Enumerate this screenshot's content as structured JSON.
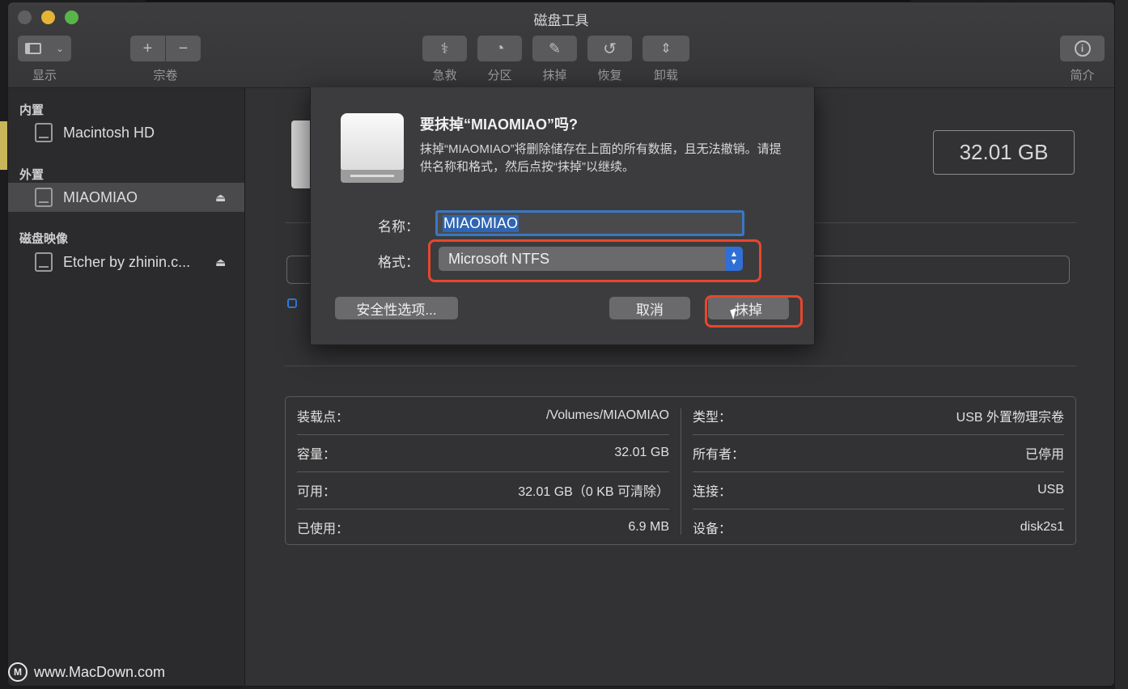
{
  "window": {
    "title": "磁盘工具"
  },
  "toolbar": {
    "view_label": "显示",
    "volume_label": "宗卷",
    "firstaid_label": "急救",
    "partition_label": "分区",
    "erase_label": "抹掉",
    "restore_label": "恢复",
    "unmount_label": "卸载",
    "info_label": "简介"
  },
  "sidebar": {
    "internal_header": "内置",
    "external_header": "外置",
    "images_header": "磁盘映像",
    "items": [
      {
        "label": "Macintosh HD",
        "selected": false
      },
      {
        "label": "MIAOMIAO",
        "selected": true
      },
      {
        "label": "Etcher by zhinin.c...",
        "selected": false
      }
    ]
  },
  "main": {
    "capacity": "32.01 GB",
    "info": {
      "mount_point_label": "装载点：",
      "mount_point_value": "/Volumes/MIAOMIAO",
      "capacity_label": "容量：",
      "capacity_value": "32.01 GB",
      "available_label": "可用：",
      "available_value": "32.01 GB（0 KB 可清除）",
      "used_label": "已使用：",
      "used_value": "6.9 MB",
      "type_label": "类型：",
      "type_value": "USB 外置物理宗卷",
      "owners_label": "所有者：",
      "owners_value": "已停用",
      "connection_label": "连接：",
      "connection_value": "USB",
      "device_label": "设备：",
      "device_value": "disk2s1"
    }
  },
  "dialog": {
    "title": "要抹掉“MIAOMIAO”吗?",
    "message": "抹掉“MIAOMIAO”将删除储存在上面的所有数据，且无法撤销。请提供名称和格式，然后点按“抹掉”以继续。",
    "name_label": "名称：",
    "name_value": "MIAOMIAO",
    "format_label": "格式：",
    "format_value": "Microsoft NTFS",
    "security_button": "安全性选项...",
    "cancel_button": "取消",
    "erase_button": "抹掉"
  },
  "watermark": {
    "text": "www.MacDown.com"
  },
  "colors": {
    "highlight": "#e8472c",
    "accent": "#2f6fd6"
  }
}
